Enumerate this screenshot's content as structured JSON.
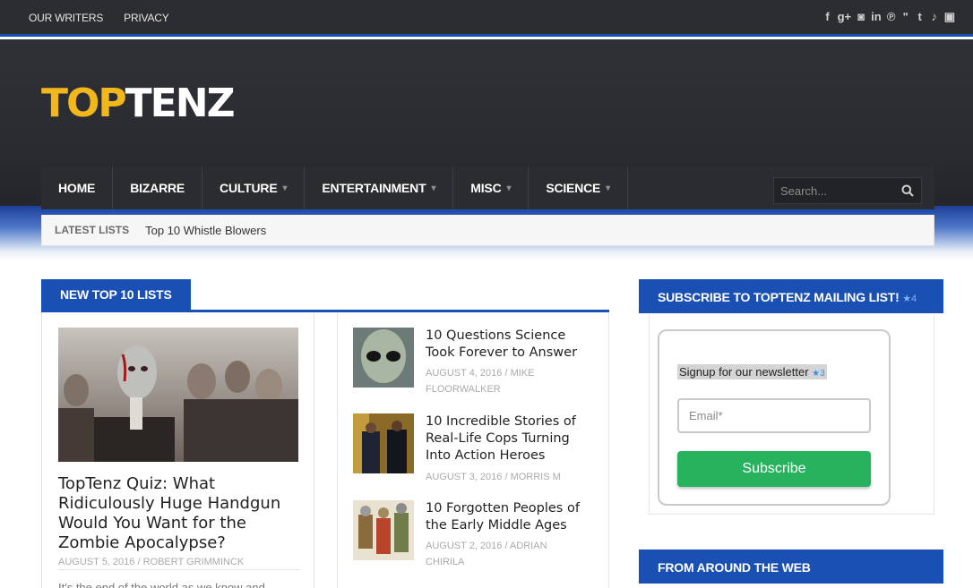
{
  "topbar": {
    "links": [
      "OUR WRITERS",
      "PRIVACY"
    ],
    "social_icons": [
      {
        "name": "facebook-icon",
        "glyph": "f"
      },
      {
        "name": "google-plus-icon",
        "glyph": "g+"
      },
      {
        "name": "instagram-icon",
        "glyph": "◙"
      },
      {
        "name": "linkedin-icon",
        "glyph": "in"
      },
      {
        "name": "pinterest-icon",
        "glyph": "℗"
      },
      {
        "name": "rss-icon",
        "glyph": "ʺ"
      },
      {
        "name": "tumblr-icon",
        "glyph": "t"
      },
      {
        "name": "twitter-icon",
        "glyph": "♪"
      },
      {
        "name": "youtube-icon",
        "glyph": "▣"
      }
    ]
  },
  "logo": {
    "part1": "TOP",
    "part2": "TENZ"
  },
  "nav": {
    "items": [
      {
        "label": "HOME",
        "dropdown": false
      },
      {
        "label": "BIZARRE",
        "dropdown": false
      },
      {
        "label": "CULTURE",
        "dropdown": true
      },
      {
        "label": "ENTERTAINMENT",
        "dropdown": true
      },
      {
        "label": "MISC",
        "dropdown": true
      },
      {
        "label": "SCIENCE",
        "dropdown": true
      }
    ],
    "search_placeholder": "Search..."
  },
  "latest": {
    "label": "LATEST LISTS",
    "title": "Top 10 Whistle Blowers"
  },
  "section_title": "NEW TOP 10 LISTS",
  "featured": {
    "title": "TopTenz Quiz: What Ridiculously Huge Handgun Would You Want for the Zombie Apocalypse?",
    "meta": "AUGUST 5, 2016 / ROBERT GRIMMINCK",
    "excerpt": "It's the end of the world as we know and"
  },
  "list_items": [
    {
      "title": "10 Questions Science Took Forever to Answer",
      "meta": "AUGUST 4, 2016 / MIKE FLOORWALKER"
    },
    {
      "title": "10 Incredible Stories of Real-Life Cops Turning Into Action Heroes",
      "meta": "AUGUST 3, 2016 / MORRIS M"
    },
    {
      "title": "10 Forgotten Peoples of the Early Middle Ages",
      "meta": "AUGUST 2, 2016 / ADRIAN CHIRILA"
    }
  ],
  "sidebar": {
    "subscribe_title": "SUBSCRIBE TO TOPTENZ MAILING LIST!",
    "subscribe_badge": "★4",
    "newsletter_text": "Signup for our newsletter",
    "newsletter_badge": "★3",
    "email_placeholder": "Email*",
    "subscribe_button": "Subscribe",
    "around_web_title": "FROM AROUND THE WEB"
  },
  "colors": {
    "accent": "#1a4fb3",
    "logo_yellow": "#f2b71a",
    "button_green": "#27b35e"
  }
}
